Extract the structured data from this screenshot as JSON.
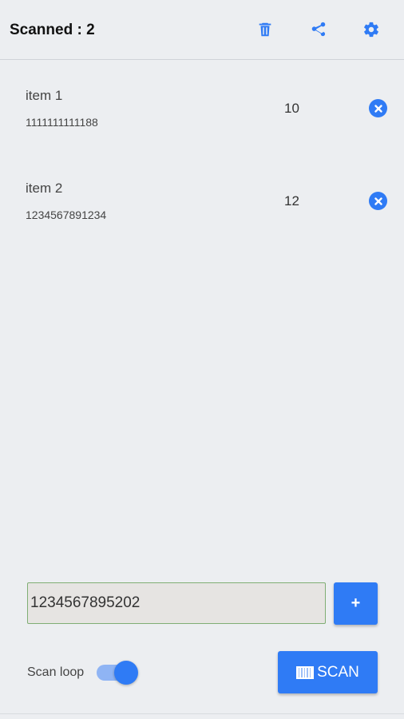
{
  "header": {
    "title": "Scanned : 2",
    "icons": [
      "trash-icon",
      "share-icon",
      "gear-icon"
    ]
  },
  "items": [
    {
      "name": "item 1",
      "code": "1111111111188",
      "qty": "10"
    },
    {
      "name": "item 2",
      "code": "1234567891234",
      "qty": "12"
    }
  ],
  "input": {
    "value": "1234567895202"
  },
  "add_button": {
    "label": "+"
  },
  "scan_loop": {
    "label": "Scan loop",
    "enabled": true
  },
  "scan_button": {
    "label": "SCAN",
    "icon": "barcode-icon"
  },
  "colors": {
    "accent": "#2f7bf5",
    "background": "#eceef1"
  }
}
